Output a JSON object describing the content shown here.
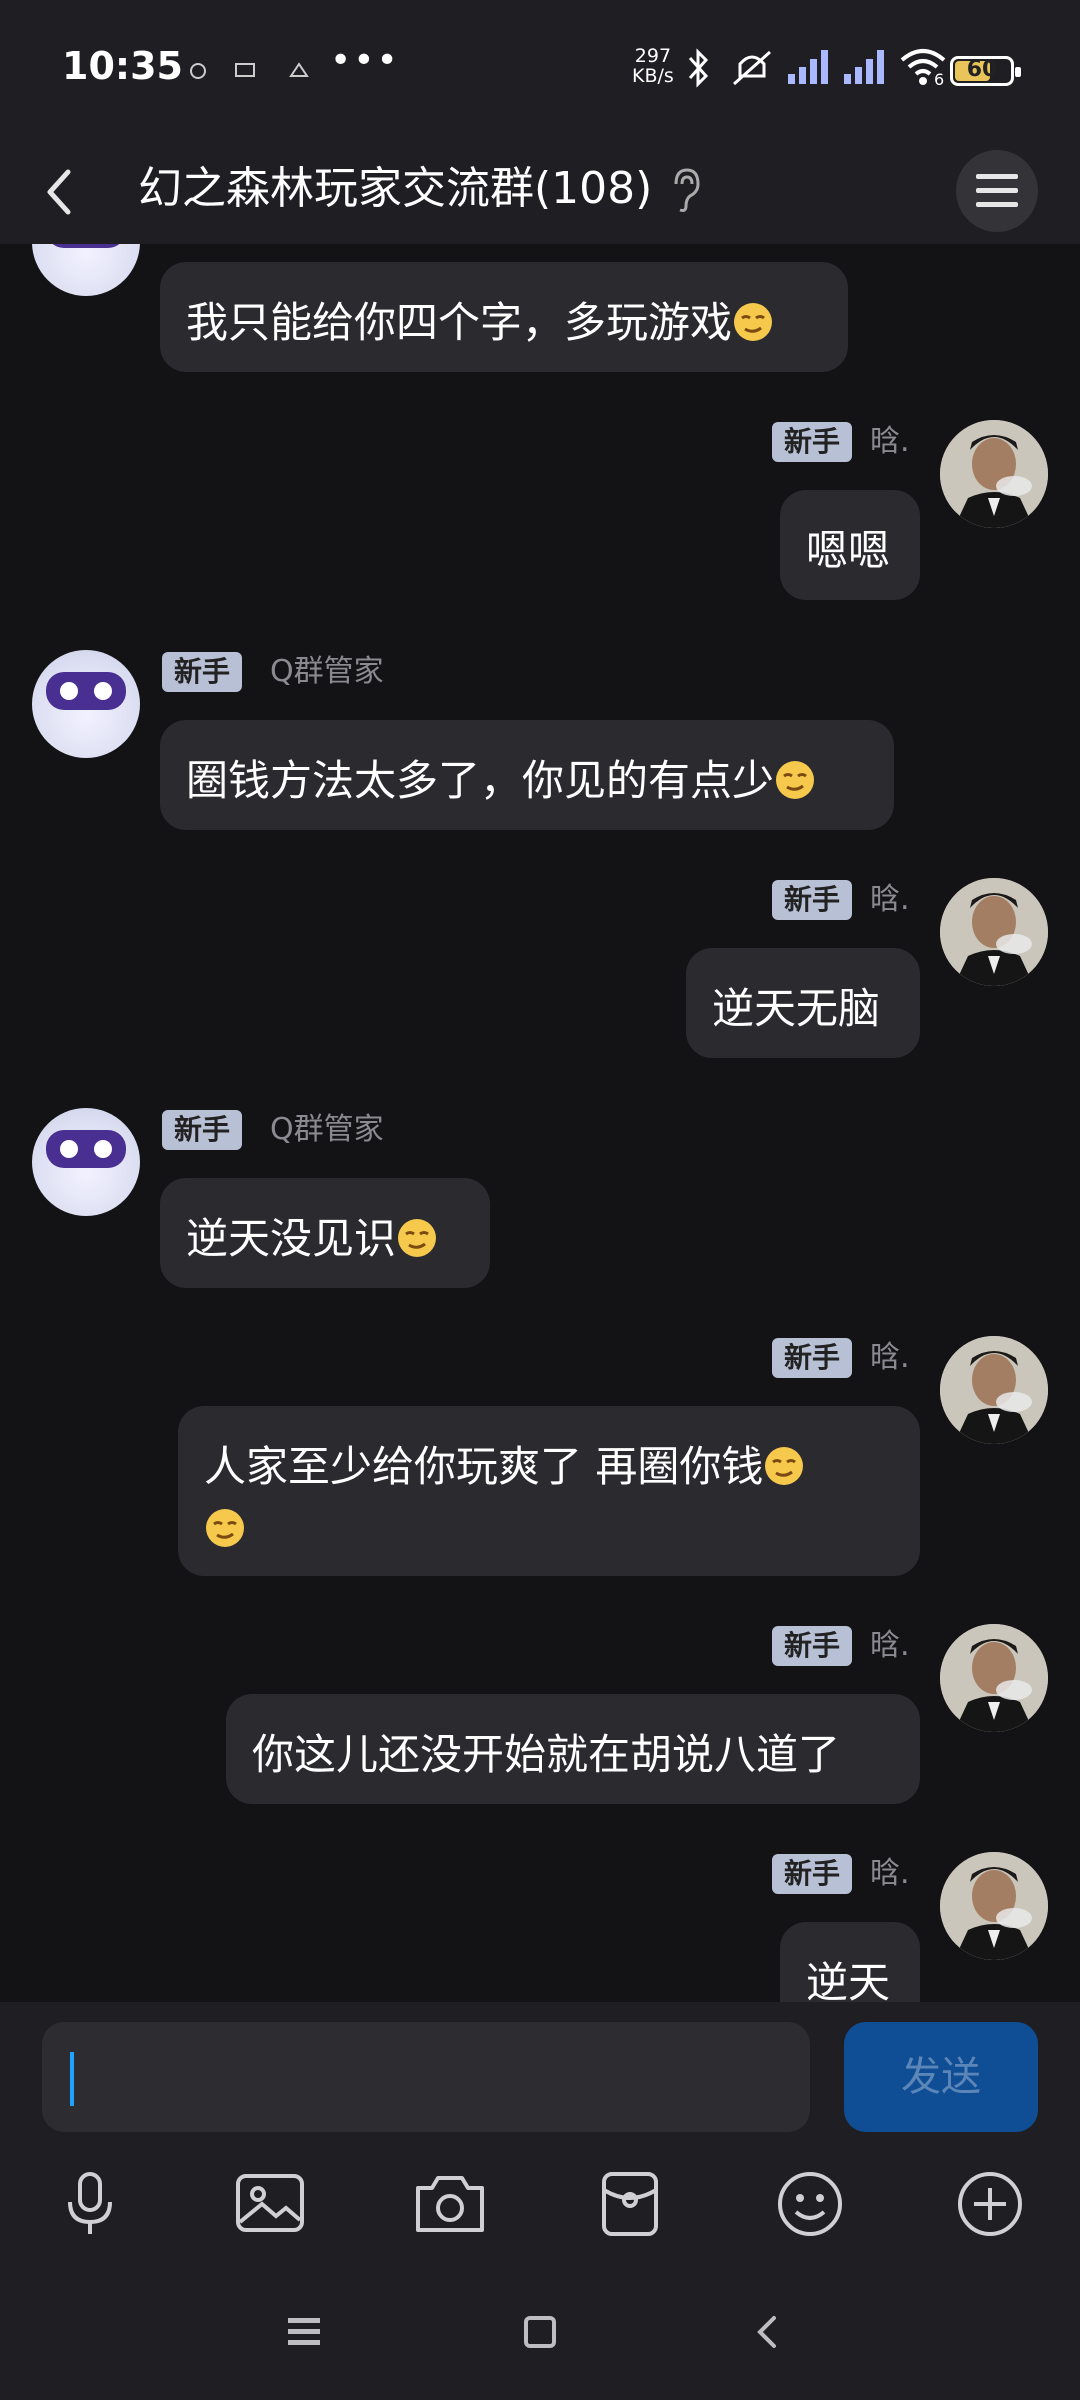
{
  "status_bar": {
    "time": "10:35",
    "net_speed_value": "297",
    "net_speed_unit": "KB/s",
    "wifi_badge": "6",
    "battery": "60",
    "battery_level": 0.6
  },
  "header": {
    "title": "幻之森林玩家交流群(108)"
  },
  "messages": [
    {
      "side": "left",
      "text": "我只能给你四个字，多玩游戏",
      "emoji_count": 1
    },
    {
      "side": "right",
      "tag": "新手",
      "nick": "晗.",
      "text": "嗯嗯"
    },
    {
      "side": "left",
      "tag": "新手",
      "nick": "Q群管家",
      "text": "圈钱方法太多了，你见的有点少",
      "emoji_count": 1
    },
    {
      "side": "right",
      "tag": "新手",
      "nick": "晗.",
      "text": "逆天无脑"
    },
    {
      "side": "left",
      "tag": "新手",
      "nick": "Q群管家",
      "text": "逆天没见识",
      "emoji_count": 1
    },
    {
      "side": "right",
      "tag": "新手",
      "nick": "晗.",
      "text": "人家至少给你玩爽了 再圈你钱",
      "emoji_count": 2
    },
    {
      "side": "right",
      "tag": "新手",
      "nick": "晗.",
      "text": "你这儿还没开始就在胡说八道了"
    },
    {
      "side": "right",
      "tag": "新手",
      "nick": "晗.",
      "text": "逆天"
    }
  ],
  "composer": {
    "send_label": "发送"
  },
  "toolbar_icons": [
    "mic-icon",
    "image-icon",
    "camera-icon",
    "red-packet-icon",
    "emoji-icon",
    "plus-icon"
  ],
  "colors": {
    "background": "#131316",
    "bubble": "#2a2a2f",
    "send_button": "#0f4e95",
    "tag": "#b8c0d6"
  }
}
